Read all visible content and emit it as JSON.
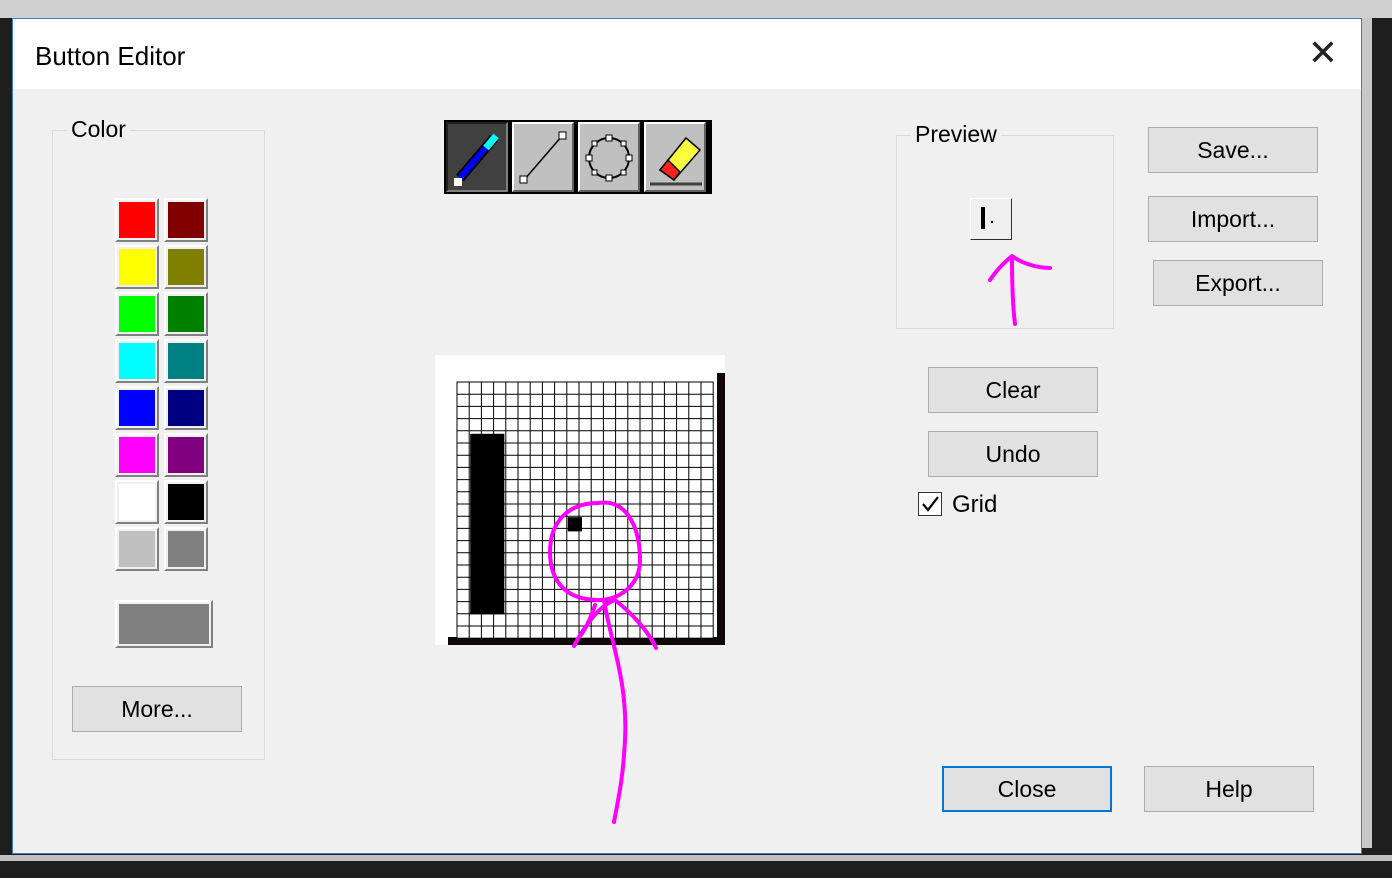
{
  "dialog": {
    "title": "Button Editor",
    "close_glyph": "✕",
    "close_icon": "close-icon"
  },
  "color_group": {
    "label": "Color",
    "palette": [
      {
        "left": "#ff0000",
        "right": "#800000"
      },
      {
        "left": "#ffff00",
        "right": "#808000"
      },
      {
        "left": "#00ff00",
        "right": "#008000"
      },
      {
        "left": "#00ffff",
        "right": "#008080"
      },
      {
        "left": "#0000ff",
        "right": "#000080"
      },
      {
        "left": "#ff00ff",
        "right": "#800080"
      },
      {
        "left": "#ffffff",
        "right": "#000000"
      },
      {
        "left": "#c0c0c0",
        "right": "#808080"
      }
    ],
    "current_color": "#808080",
    "more_label": "More..."
  },
  "tools": [
    {
      "name": "pencil-icon",
      "active": true
    },
    {
      "name": "line-icon",
      "active": false
    },
    {
      "name": "ellipse-icon",
      "active": false
    },
    {
      "name": "eraser-icon",
      "active": false
    }
  ],
  "preview": {
    "label": "Preview"
  },
  "buttons": {
    "save": "Save...",
    "import": "Import...",
    "export": "Export...",
    "clear": "Clear",
    "undo": "Undo",
    "close": "Close",
    "help": "Help"
  },
  "grid_checkbox": {
    "label": "Grid",
    "checked": true
  },
  "annotation_color": "#ff00ff"
}
